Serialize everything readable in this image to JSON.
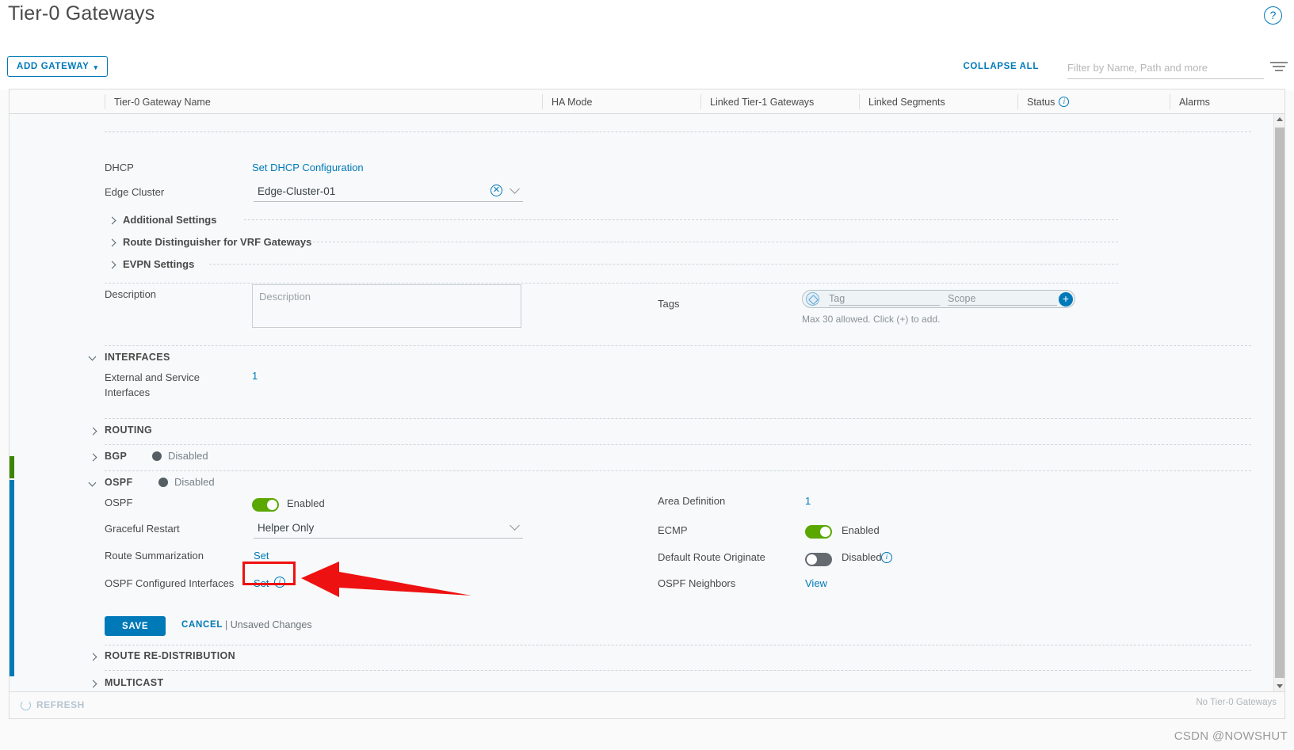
{
  "header": {
    "title": "Tier-0 Gateways",
    "help_icon": "help-circle-icon"
  },
  "toolbar": {
    "add_gateway_label": "ADD GATEWAY",
    "add_gateway_caret": "⌄",
    "collapse_all_label": "COLLAPSE ALL",
    "filter_placeholder": "Filter by Name, Path and more",
    "filter_value": "",
    "filter_icon": "filter-icon"
  },
  "table": {
    "columns": [
      "Tier-0 Gateway Name",
      "HA Mode",
      "Linked Tier-1 Gateways",
      "Linked Segments",
      "Status",
      "Alarms"
    ],
    "status_info_icon": "info-icon"
  },
  "detail": {
    "dhcp": {
      "label": "DHCP",
      "link": "Set DHCP Configuration"
    },
    "edge_cluster": {
      "label": "Edge Cluster",
      "value": "Edge-Cluster-01",
      "clear_icon": "clear-circle-icon",
      "chevron_icon": "chevron-down-icon"
    },
    "collapsed_sections": [
      "Additional Settings",
      "Route Distinguisher for VRF Gateways",
      "EVPN Settings"
    ],
    "description": {
      "label": "Description",
      "placeholder": "Description",
      "value": ""
    },
    "tags": {
      "label": "Tags",
      "tag_placeholder": "Tag",
      "tag_value": "",
      "scope_placeholder": "Scope",
      "scope_value": "",
      "add_icon": "plus-icon",
      "tag_icon": "tag-icon",
      "hint": "Max 30 allowed. Click (+) to add."
    },
    "interfaces": {
      "title": "INTERFACES",
      "expanded": true,
      "rows": [
        {
          "label": "External and Service Interfaces",
          "value": "1"
        }
      ]
    },
    "routing": {
      "title": "ROUTING",
      "expanded": false
    },
    "bgp": {
      "title": "BGP",
      "state": "Disabled",
      "expanded": false
    },
    "ospf": {
      "title": "OSPF",
      "state": "Disabled",
      "expanded": true,
      "left": {
        "ospf_label": "OSPF",
        "ospf_toggle_state": "on",
        "ospf_toggle_text": "Enabled",
        "graceful_restart_label": "Graceful Restart",
        "graceful_restart_value": "Helper Only",
        "route_summarization_label": "Route Summarization",
        "route_summarization_link": "Set",
        "configured_interfaces_label": "OSPF Configured Interfaces",
        "configured_interfaces_link": "Set",
        "configured_interfaces_info_icon": "info-icon"
      },
      "right": {
        "area_definition_label": "Area Definition",
        "area_definition_value": "1",
        "ecmp_label": "ECMP",
        "ecmp_toggle_state": "on",
        "ecmp_toggle_text": "Enabled",
        "default_route_label": "Default Route Originate",
        "default_route_toggle_state": "off",
        "default_route_toggle_text": "Disabled",
        "default_route_info_icon": "info-icon",
        "neighbors_label": "OSPF Neighbors",
        "neighbors_link": "View"
      },
      "actions": {
        "save_label": "SAVE",
        "cancel_label": "CANCEL",
        "unsaved_label": "| Unsaved Changes"
      }
    },
    "route_redistribution": {
      "title": "ROUTE RE-DISTRIBUTION",
      "expanded": false
    },
    "multicast": {
      "title": "MULTICAST",
      "expanded": false
    }
  },
  "footer": {
    "refresh_label": "REFRESH",
    "refresh_icon": "refresh-icon",
    "no_results": "No Tier-0 Gateways"
  },
  "annotation": {
    "highlight_target": "ospf-configured-interfaces-set-link",
    "arrow_color": "#ee1111",
    "box_color": "#ee1111"
  },
  "watermark": "CSDN @NOWSHUT",
  "colors": {
    "accent": "#0079b8",
    "toggle_on": "#5aa700",
    "toggle_off": "#646a70",
    "status_green": "#3c8500",
    "status_blue": "#0079b8",
    "annotation_red": "#ee1111"
  }
}
